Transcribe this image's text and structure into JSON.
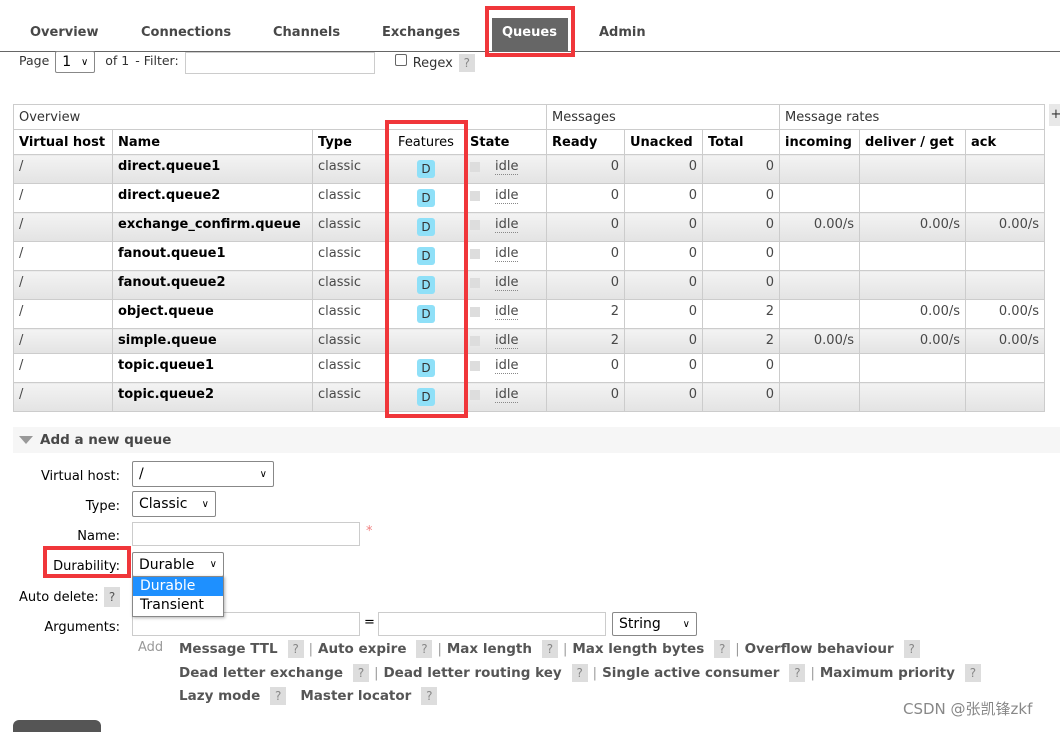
{
  "tabs": [
    "Overview",
    "Connections",
    "Channels",
    "Exchanges",
    "Queues",
    "Admin"
  ],
  "active_tab": "Queues",
  "pager": {
    "page_label": "Page",
    "page_value": "1",
    "of_label": "of 1",
    "filter_label": "- Filter:",
    "filter_value": "",
    "regex_label": "Regex",
    "help": "?"
  },
  "table": {
    "groups": [
      "Overview",
      "Messages",
      "Message rates"
    ],
    "plus": "+",
    "columns": [
      "Virtual host",
      "Name",
      "Type",
      "Features",
      "State",
      "Ready",
      "Unacked",
      "Total",
      "incoming",
      "deliver / get",
      "ack"
    ],
    "rows": [
      {
        "vhost": "/",
        "name": "direct.queue1",
        "type": "classic",
        "features": "D",
        "state": "idle",
        "ready": "0",
        "unacked": "0",
        "total": "0",
        "incoming": "",
        "deliver": "",
        "ack": ""
      },
      {
        "vhost": "/",
        "name": "direct.queue2",
        "type": "classic",
        "features": "D",
        "state": "idle",
        "ready": "0",
        "unacked": "0",
        "total": "0",
        "incoming": "",
        "deliver": "",
        "ack": ""
      },
      {
        "vhost": "/",
        "name": "exchange_confirm.queue",
        "type": "classic",
        "features": "D",
        "state": "idle",
        "ready": "0",
        "unacked": "0",
        "total": "0",
        "incoming": "0.00/s",
        "deliver": "0.00/s",
        "ack": "0.00/s"
      },
      {
        "vhost": "/",
        "name": "fanout.queue1",
        "type": "classic",
        "features": "D",
        "state": "idle",
        "ready": "0",
        "unacked": "0",
        "total": "0",
        "incoming": "",
        "deliver": "",
        "ack": ""
      },
      {
        "vhost": "/",
        "name": "fanout.queue2",
        "type": "classic",
        "features": "D",
        "state": "idle",
        "ready": "0",
        "unacked": "0",
        "total": "0",
        "incoming": "",
        "deliver": "",
        "ack": ""
      },
      {
        "vhost": "/",
        "name": "object.queue",
        "type": "classic",
        "features": "D",
        "state": "idle",
        "ready": "2",
        "unacked": "0",
        "total": "2",
        "incoming": "",
        "deliver": "0.00/s",
        "ack": "0.00/s"
      },
      {
        "vhost": "/",
        "name": "simple.queue",
        "type": "classic",
        "features": "",
        "state": "idle",
        "ready": "2",
        "unacked": "0",
        "total": "2",
        "incoming": "0.00/s",
        "deliver": "0.00/s",
        "ack": "0.00/s"
      },
      {
        "vhost": "/",
        "name": "topic.queue1",
        "type": "classic",
        "features": "D",
        "state": "idle",
        "ready": "0",
        "unacked": "0",
        "total": "0",
        "incoming": "",
        "deliver": "",
        "ack": ""
      },
      {
        "vhost": "/",
        "name": "topic.queue2",
        "type": "classic",
        "features": "D",
        "state": "idle",
        "ready": "0",
        "unacked": "0",
        "total": "0",
        "incoming": "",
        "deliver": "",
        "ack": ""
      }
    ]
  },
  "add_queue": {
    "title": "Add a new queue",
    "vhost_label": "Virtual host:",
    "vhost_value": "/",
    "type_label": "Type:",
    "type_value": "Classic",
    "name_label": "Name:",
    "name_value": "",
    "required": "*",
    "durability_label": "Durability:",
    "durability_value": "Durable",
    "durability_options": [
      "Durable",
      "Transient"
    ],
    "durability_selected": "Durable",
    "auto_delete_label": "Auto delete:",
    "help": "?",
    "arguments_label": "Arguments:",
    "eq": "=",
    "arg_type": "String",
    "add_label": "Add",
    "arg_lines": [
      [
        "Message TTL",
        "Auto expire",
        "Max length",
        "Max length bytes",
        "Overflow behaviour"
      ],
      [
        "Dead letter exchange",
        "Dead letter routing key",
        "Single active consumer",
        "Maximum priority"
      ],
      [
        "Lazy mode",
        "Master locator"
      ]
    ]
  },
  "watermark": "CSDN @张凯锋zkf",
  "colors": {
    "highlight": "#f0363a",
    "active_tab": "#666666",
    "badge": "#8fe0f8",
    "option_selected": "#1e90ff"
  }
}
